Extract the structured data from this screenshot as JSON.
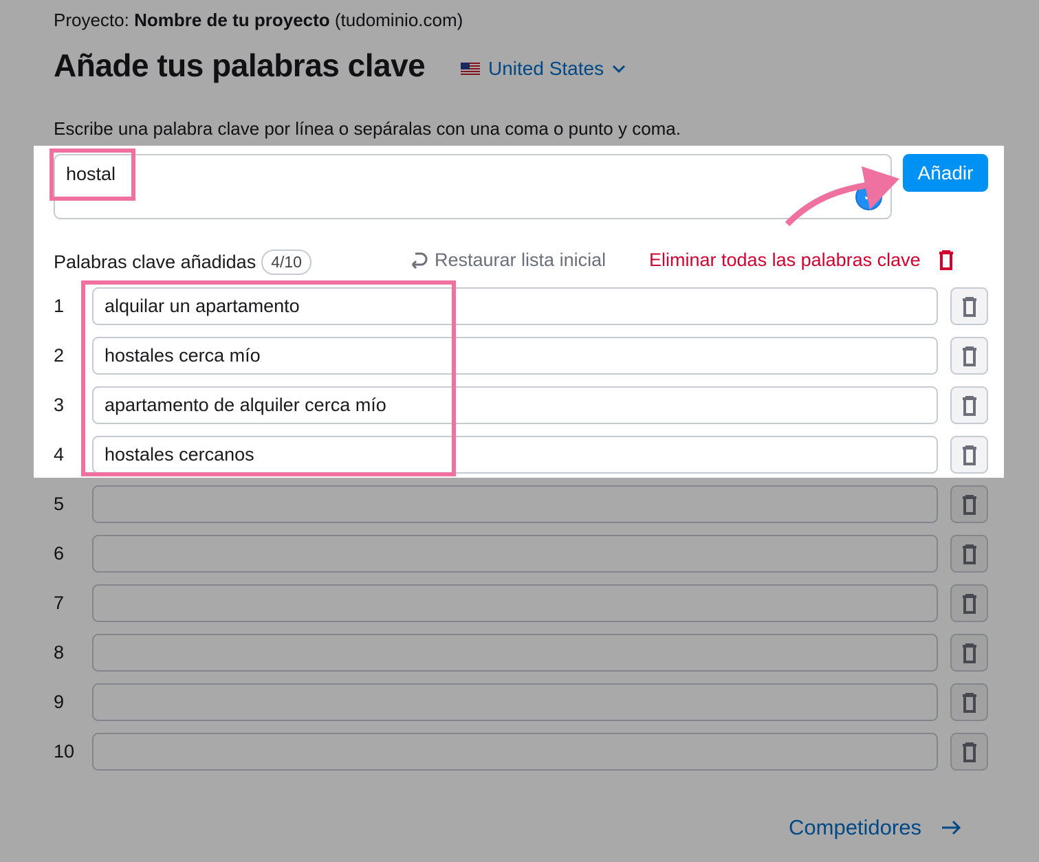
{
  "project": {
    "label": "Proyecto:",
    "name": "Nombre de tu proyecto",
    "domain": "(tudominio.com)"
  },
  "heading": "Añade tus palabras clave",
  "country": {
    "flag": "us-flag-icon",
    "label": "United States"
  },
  "instructions": "Escribe una palabra clave por línea o sepáralas con una coma o punto y coma.",
  "input": {
    "value": "hostal"
  },
  "add_button": "Añadir",
  "added": {
    "label": "Palabras clave añadidas",
    "count": "4/10"
  },
  "restore_label": "Restaurar lista inicial",
  "delete_all_label": "Eliminar todas las palabras clave",
  "keywords": [
    {
      "num": "1",
      "value": "alquilar un apartamento"
    },
    {
      "num": "2",
      "value": "hostales cerca mío"
    },
    {
      "num": "3",
      "value": "apartamento de alquiler cerca mío"
    },
    {
      "num": "4",
      "value": "hostales cercanos"
    },
    {
      "num": "5",
      "value": ""
    },
    {
      "num": "6",
      "value": ""
    },
    {
      "num": "7",
      "value": ""
    },
    {
      "num": "8",
      "value": ""
    },
    {
      "num": "9",
      "value": ""
    },
    {
      "num": "10",
      "value": ""
    }
  ],
  "next_link": "Competidores",
  "colors": {
    "accent": "#0091f5",
    "link": "#006dca",
    "danger": "#d1002f",
    "highlight": "#ee719f"
  }
}
